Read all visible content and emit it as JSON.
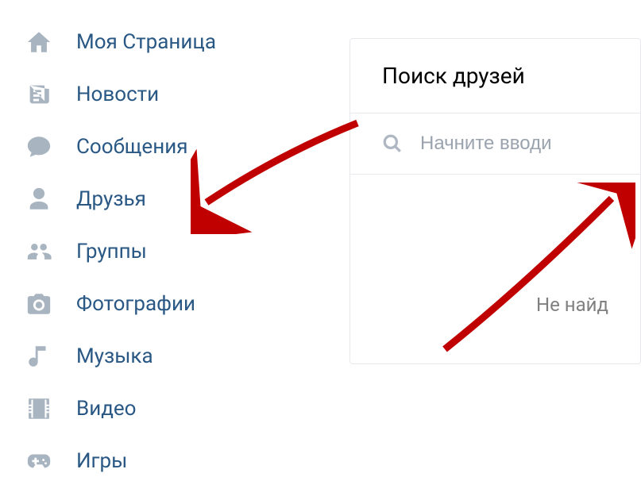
{
  "sidebar": {
    "items": [
      {
        "label": "Моя Страница",
        "icon": "home-icon"
      },
      {
        "label": "Новости",
        "icon": "news-icon"
      },
      {
        "label": "Сообщения",
        "icon": "messages-icon"
      },
      {
        "label": "Друзья",
        "icon": "friends-icon"
      },
      {
        "label": "Группы",
        "icon": "groups-icon"
      },
      {
        "label": "Фотографии",
        "icon": "photos-icon"
      },
      {
        "label": "Музыка",
        "icon": "music-icon"
      },
      {
        "label": "Видео",
        "icon": "videos-icon"
      },
      {
        "label": "Игры",
        "icon": "games-icon"
      }
    ]
  },
  "main": {
    "title": "Поиск друзей",
    "search_placeholder": "Начните вводи",
    "no_results": "Не найд"
  }
}
